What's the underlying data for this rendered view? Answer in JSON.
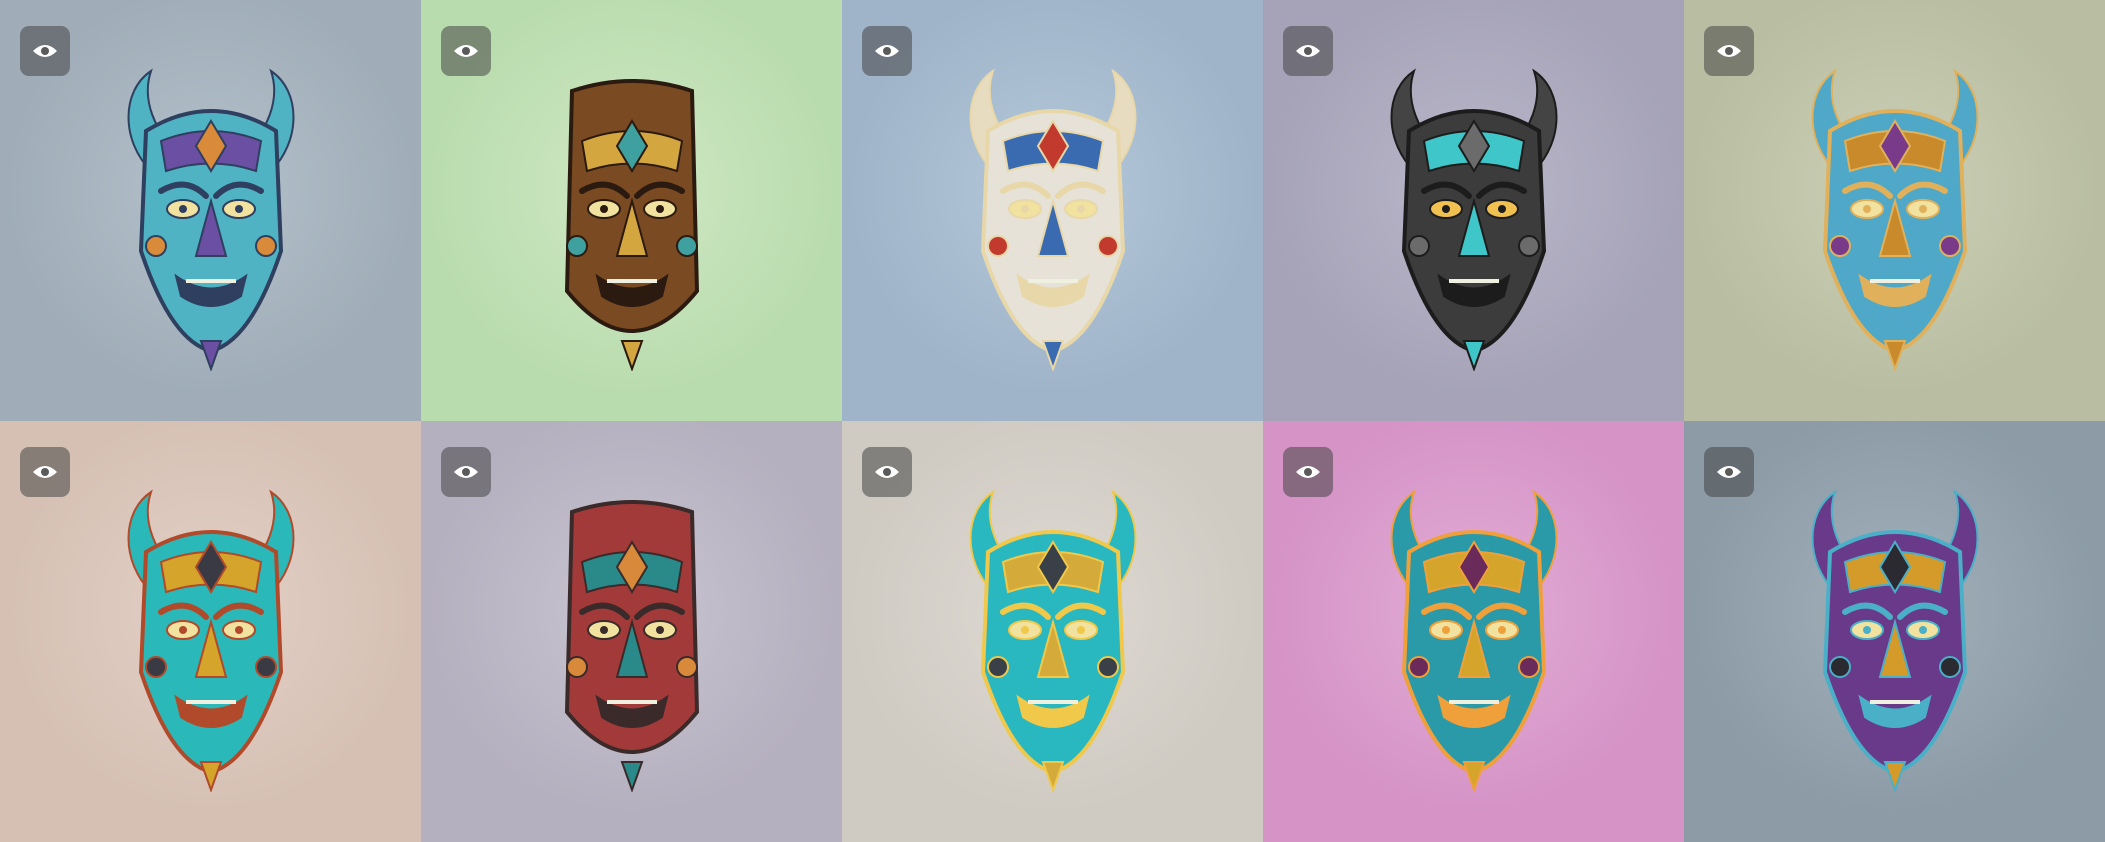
{
  "gallery": {
    "tiles": [
      {
        "bg": "#a0adb8",
        "glow": "#b4c1cb",
        "icon": "eye-icon",
        "mask": {
          "kind": "horned",
          "c1": "#4fb3c4",
          "c2": "#6b4fa3",
          "c3": "#d98b3a",
          "c4": "#2f3f5f"
        }
      },
      {
        "bg": "#b9dcae",
        "glow": "#cfe8c4",
        "icon": "eye-icon",
        "mask": {
          "kind": "tiki",
          "c1": "#7a4a22",
          "c2": "#d4a640",
          "c3": "#3fa0a0",
          "c4": "#2b1a10"
        }
      },
      {
        "bg": "#9fb4c9",
        "glow": "#b5c8da",
        "icon": "eye-icon",
        "mask": {
          "kind": "oni",
          "c1": "#e6e2d7",
          "c2": "#3a6ab0",
          "c3": "#c23a2e",
          "c4": "#e8d7a8"
        }
      },
      {
        "bg": "#a6a3b8",
        "glow": "#bab7ca",
        "icon": "eye-icon",
        "mask": {
          "kind": "stone",
          "c1": "#3c3c3c",
          "c2": "#3fc6c8",
          "c3": "#6b6b6b",
          "c4": "#1c1c1c"
        }
      },
      {
        "bg": "#b9bea2",
        "glow": "#ccd0b6",
        "icon": "eye-icon",
        "mask": {
          "kind": "goddess",
          "c1": "#4fa8c8",
          "c2": "#c88a2a",
          "c3": "#7a3a8a",
          "c4": "#e0b05a"
        }
      },
      {
        "bg": "#d6c0b4",
        "glow": "#e2d0c6",
        "icon": "eye-icon",
        "mask": {
          "kind": "horned2",
          "c1": "#2ab8b8",
          "c2": "#d4a52a",
          "c3": "#3a3a44",
          "c4": "#b04a2a"
        }
      },
      {
        "bg": "#b5b0bf",
        "glow": "#c8c4d1",
        "icon": "eye-icon",
        "mask": {
          "kind": "long",
          "c1": "#a33a3a",
          "c2": "#2a8a8a",
          "c3": "#d88a3a",
          "c4": "#3a2a2a"
        }
      },
      {
        "bg": "#cfcbc3",
        "glow": "#dedad3",
        "icon": "eye-icon",
        "mask": {
          "kind": "horned3",
          "c1": "#2ab8c0",
          "c2": "#d4aa3a",
          "c3": "#3a4048",
          "c4": "#f0c84a"
        }
      },
      {
        "bg": "#d593c6",
        "glow": "#e2acd6",
        "icon": "eye-icon",
        "mask": {
          "kind": "demon",
          "c1": "#2a9aa8",
          "c2": "#d4a52a",
          "c3": "#6a2a5a",
          "c4": "#f0a03a"
        }
      },
      {
        "bg": "#8c9ba6",
        "glow": "#a2b0ba",
        "icon": "eye-icon",
        "mask": {
          "kind": "warrior",
          "c1": "#6a3a8a",
          "c2": "#d49a2a",
          "c3": "#2a2a30",
          "c4": "#4ab0c8"
        }
      }
    ]
  }
}
